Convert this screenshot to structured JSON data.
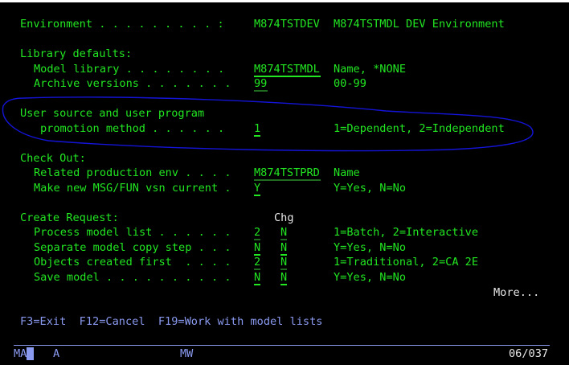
{
  "environment": {
    "label": "Environment . . . . . . . . . :",
    "value": "M874TSTDEV",
    "desc": "M874TSTMDL DEV Environment"
  },
  "library_defaults": {
    "heading": "Library defaults:",
    "model_library": {
      "label": "Model library . . . . . . . .",
      "value": "M874TSTMDL",
      "hint": "Name, *NONE"
    },
    "archive_versions": {
      "label": "Archive versions . . . . . . .",
      "value": "99",
      "hint": "00-99"
    }
  },
  "promotion": {
    "label1": "User source and user program",
    "label2": "promotion method . . . . . .",
    "value": "1",
    "hint": "1=Dependent, 2=Independent"
  },
  "check_out": {
    "heading": "Check Out:",
    "related_env": {
      "label": "Related production env . . . .",
      "value": "M874TSTPRD",
      "hint": "Name"
    },
    "make_current": {
      "label": "Make new MSG/FUN vsn current .",
      "value": "Y",
      "hint": "Y=Yes, N=No"
    }
  },
  "create_request": {
    "heading": "Create Request:",
    "chg_header": "Chg",
    "rows": [
      {
        "label": "Process model list . . . . . .",
        "value": "2",
        "chg": "N",
        "hint": "1=Batch, 2=Interactive"
      },
      {
        "label": "Separate model copy step . . .",
        "value": "N",
        "chg": "N",
        "hint": "Y=Yes, N=No"
      },
      {
        "label": "Objects created first  . . . .",
        "value": "2",
        "chg": "N",
        "hint": "1=Traditional, 2=CA 2E"
      },
      {
        "label": "Save model . . . . . . . . . .",
        "value": "N",
        "chg": "N",
        "hint": "Y=Yes, N=No"
      }
    ]
  },
  "more": "More...",
  "function_keys": "F3=Exit  F12=Cancel  F19=Work with model lists",
  "status": {
    "left": "MA",
    "mode": "A",
    "mw": "MW",
    "position": "06/037"
  },
  "annotation_color": "#1010d0"
}
